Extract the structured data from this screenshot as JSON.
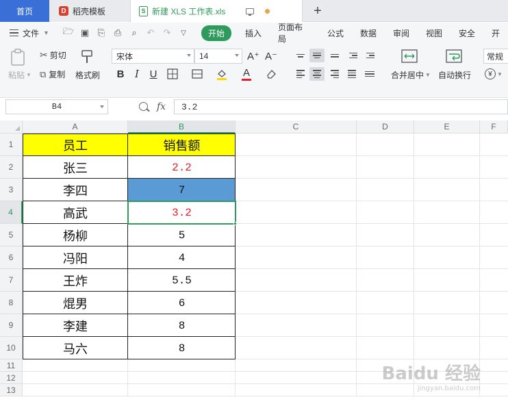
{
  "tabs": {
    "home": "首页",
    "template": "稻壳模板",
    "document": "新建 XLS 工作表.xls",
    "add": "+"
  },
  "menubar": {
    "file": "文件",
    "tabs": [
      "开始",
      "插入",
      "页面布局",
      "公式",
      "数据",
      "审阅",
      "视图",
      "安全",
      "开"
    ]
  },
  "ribbon": {
    "paste": "粘贴",
    "cut": "剪切",
    "copy": "复制",
    "format_painter": "格式刷",
    "font_name": "宋体",
    "font_size": "14",
    "merge_center": "合并居中",
    "wrap_text": "自动换行",
    "number_format": "常规",
    "currency_symbol": "¥",
    "bold": "B",
    "italic": "I",
    "underline": "U",
    "text_color_letter": "A",
    "font_grow": "A⁺",
    "font_shrink": "A⁻"
  },
  "formula_bar": {
    "cell_ref": "B4",
    "fx": "fx",
    "value": "3.2"
  },
  "columns": [
    "A",
    "B",
    "C",
    "D",
    "E",
    "F"
  ],
  "rows": [
    "1",
    "2",
    "3",
    "4",
    "5",
    "6",
    "7",
    "8",
    "9",
    "10",
    "11",
    "12",
    "13"
  ],
  "sheet": {
    "header": [
      "员工",
      "销售额"
    ],
    "data": [
      {
        "name": "张三",
        "sales": "2.2",
        "color": "#e0202a",
        "fill": ""
      },
      {
        "name": "李四",
        "sales": "7",
        "color": "#111111",
        "fill": "#5b9bd5"
      },
      {
        "name": "高武",
        "sales": "3.2",
        "color": "#e0202a",
        "fill": ""
      },
      {
        "name": "杨柳",
        "sales": "5",
        "color": "#111111",
        "fill": ""
      },
      {
        "name": "冯阳",
        "sales": "4",
        "color": "#111111",
        "fill": ""
      },
      {
        "name": "王炸",
        "sales": "5.5",
        "color": "#111111",
        "fill": ""
      },
      {
        "name": "焜男",
        "sales": "6",
        "color": "#111111",
        "fill": ""
      },
      {
        "name": "李建",
        "sales": "8",
        "color": "#111111",
        "fill": ""
      },
      {
        "name": "马六",
        "sales": "8",
        "color": "#111111",
        "fill": ""
      }
    ]
  },
  "selected_cell": "B4",
  "watermark": {
    "main": "Baidu 经验",
    "sub": "jingyan.baidu.com"
  },
  "colors": {
    "accent": "#2e9a5b",
    "home_tab": "#3a6fd8",
    "header_fill": "#ffff00",
    "highlight_fill": "#5b9bd5",
    "red_text": "#e0202a"
  }
}
